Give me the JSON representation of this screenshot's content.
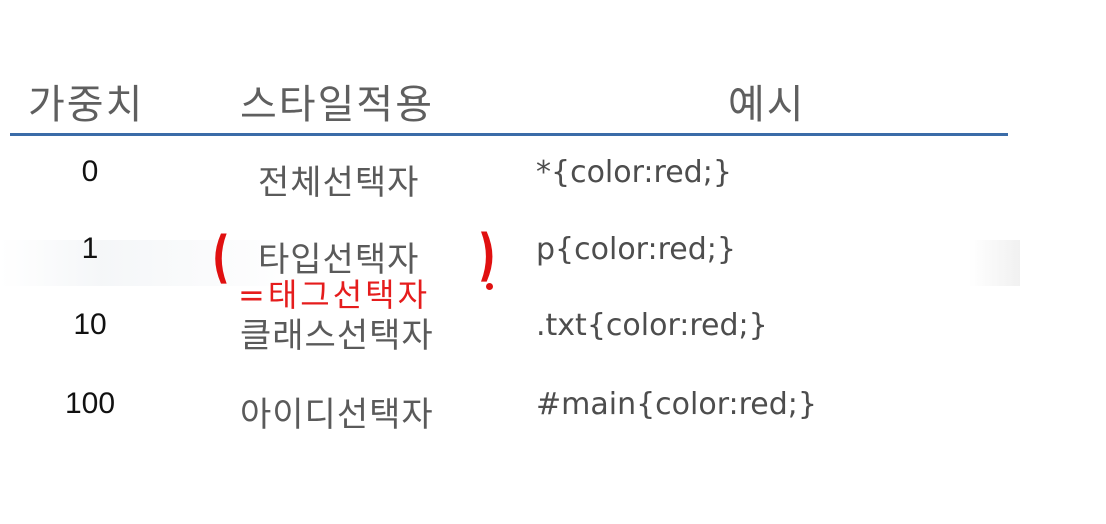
{
  "table": {
    "headers": {
      "weight": "가중치",
      "style": "스타일적용",
      "example": "예시"
    },
    "rows": [
      {
        "weight": "0",
        "style": "전체선택자",
        "example": "*{color:red;}"
      },
      {
        "weight": "1",
        "style": "타입선택자",
        "example": "p{color:red;}"
      },
      {
        "weight": "10",
        "style": "클래스선택자",
        "example": ".txt{color:red;}"
      },
      {
        "weight": "100",
        "style": "아이디선택자",
        "example": "#main{color:red;}"
      }
    ]
  },
  "annotation": {
    "text": "=태그선택자",
    "open_paren": "(",
    "close_paren": ")"
  },
  "colors": {
    "rule": "#3b6ca8",
    "annotation": "#e01010"
  }
}
